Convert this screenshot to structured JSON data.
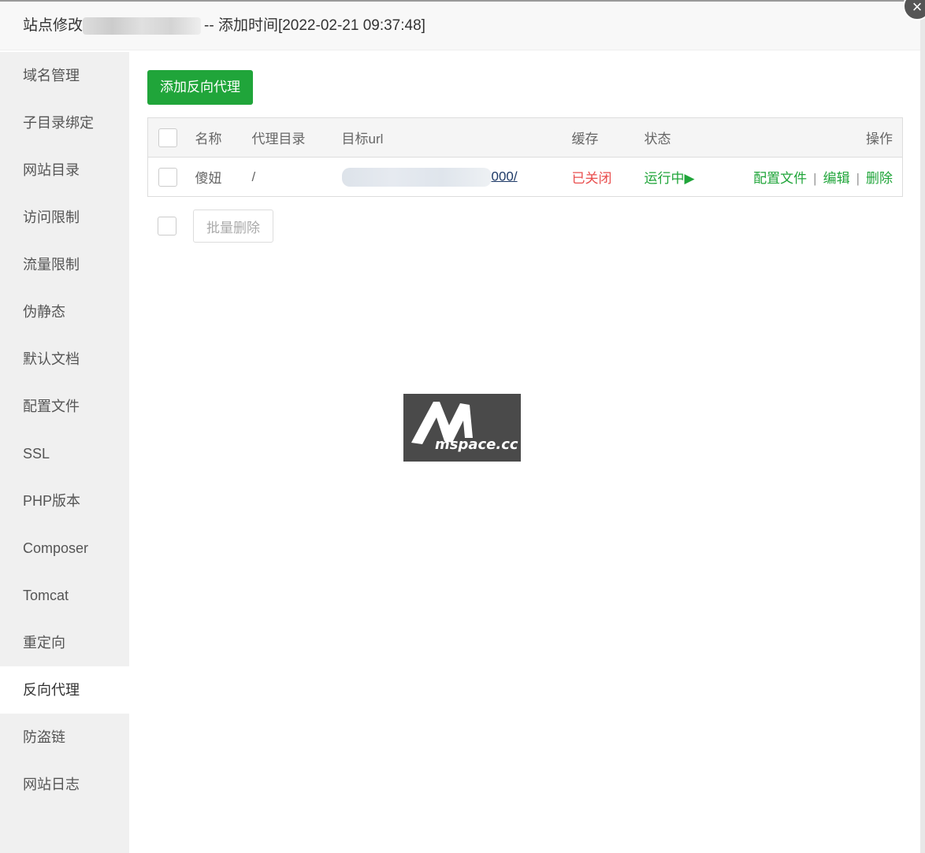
{
  "dialog": {
    "title_prefix": "站点修改",
    "title_suffix": "-- 添加时间[2022-02-21 09:37:48]",
    "close": "×"
  },
  "sidebar": {
    "items": [
      {
        "label": "域名管理"
      },
      {
        "label": "子目录绑定"
      },
      {
        "label": "网站目录"
      },
      {
        "label": "访问限制"
      },
      {
        "label": "流量限制"
      },
      {
        "label": "伪静态"
      },
      {
        "label": "默认文档"
      },
      {
        "label": "配置文件"
      },
      {
        "label": "SSL"
      },
      {
        "label": "PHP版本"
      },
      {
        "label": "Composer"
      },
      {
        "label": "Tomcat"
      },
      {
        "label": "重定向"
      },
      {
        "label": "反向代理"
      },
      {
        "label": "防盗链"
      },
      {
        "label": "网站日志"
      }
    ],
    "active": "反向代理"
  },
  "main": {
    "add_button": "添加反向代理",
    "table": {
      "headers": [
        "名称",
        "代理目录",
        "目标url",
        "缓存",
        "状态",
        "操作"
      ],
      "rows": [
        {
          "name": "傻妞",
          "dir": "/",
          "url": "000/",
          "cache": "已关闭",
          "status": "运行中▶",
          "actions": [
            "配置文件",
            "编辑",
            "删除"
          ]
        }
      ]
    },
    "batch_delete": "批量删除"
  },
  "watermark": {
    "text": "mspace.cc"
  }
}
